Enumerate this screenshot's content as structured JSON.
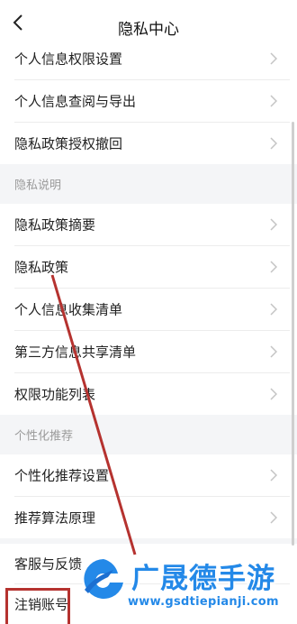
{
  "header": {
    "title": "隐私中心",
    "back_icon": "back-arrow-icon"
  },
  "items_top": [
    {
      "label": "个人信息权限设置"
    },
    {
      "label": "个人信息查阅与导出"
    },
    {
      "label": "隐私政策授权撤回"
    }
  ],
  "section_privacy": {
    "label": "隐私说明"
  },
  "items_privacy": [
    {
      "label": "隐私政策摘要"
    },
    {
      "label": "隐私政策"
    },
    {
      "label": "个人信息收集清单"
    },
    {
      "label": "第三方信息共享清单"
    },
    {
      "label": "权限功能列表"
    }
  ],
  "section_personal": {
    "label": "个性化推荐"
  },
  "items_personal": [
    {
      "label": "个性化推荐设置"
    },
    {
      "label": "推荐算法原理"
    }
  ],
  "items_bottom": [
    {
      "label": "客服与反馈"
    },
    {
      "label": "注销账号"
    }
  ],
  "watermark": {
    "title": "广晟德手游",
    "url": "www.gsdtiepianji.com"
  },
  "colors": {
    "annotation_red": "#b5322f",
    "watermark_blue": "#2489e8",
    "section_bg": "#f4f5f7"
  }
}
